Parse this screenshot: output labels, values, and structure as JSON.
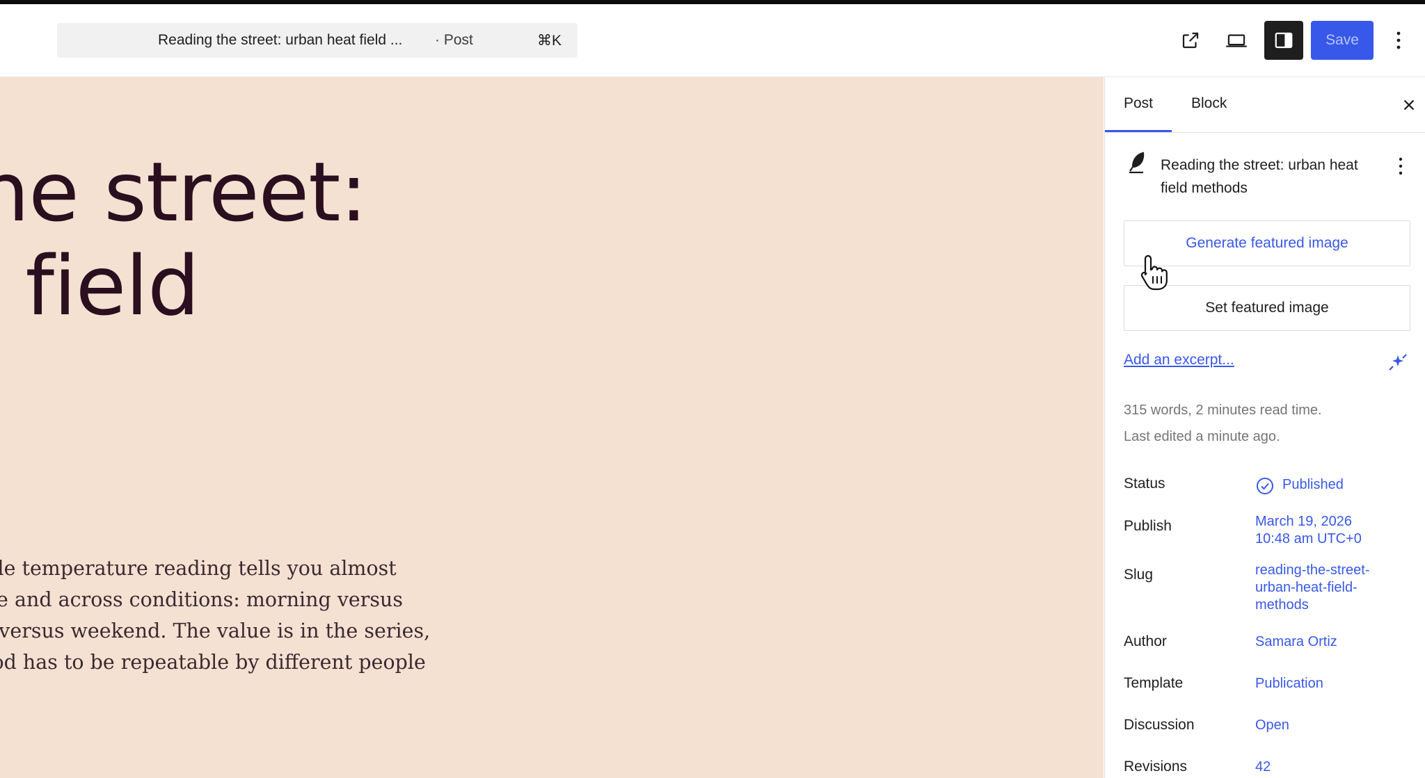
{
  "header": {
    "document_title": "Reading the street: urban heat field ...",
    "document_type": "· Post",
    "shortcut": "⌘K",
    "save_label": "Save"
  },
  "canvas": {
    "title_lines": "ng the street:\n heat field\nods",
    "excerpt": "matter A single temperature reading tells you almost\nerge over time and across conditions: morning versus\near, weekday versus weekend. The value is in the series,\nans the method has to be repeatable by different people\n. If your..."
  },
  "sidebar": {
    "tabs": [
      "Post",
      "Block"
    ],
    "active_tab": "Post",
    "post_title": "Reading the street: urban heat field methods",
    "generate_featured_label": "Generate featured image",
    "set_featured_label": "Set featured image",
    "excerpt_link": "Add an excerpt...",
    "word_count": "315 words, 2 minutes read time.",
    "last_edited": "Last edited a minute ago.",
    "fields": [
      {
        "label": "Status",
        "value": "Published"
      },
      {
        "label": "Publish",
        "value": "March 19, 2026\n10:48 am UTC+0"
      },
      {
        "label": "Slug",
        "value": "reading-the-street-\nurban-heat-field-\nmethods"
      },
      {
        "label": "Author",
        "value": "Samara Ortiz"
      },
      {
        "label": "Template",
        "value": "Publication"
      },
      {
        "label": "Discussion",
        "value": "Open"
      },
      {
        "label": "Revisions",
        "value": "42"
      }
    ]
  },
  "icons": {
    "view": "external-link-icon",
    "preview": "desktop-preview-icon",
    "settings": "sidebar-toggle-icon",
    "options": "more-vertical-icon",
    "close": "close-icon",
    "post_card": "feather-icon",
    "ai": "ai-sparkle-icon",
    "status": "check-circle-icon",
    "cursor": "hand-pointer-icon"
  },
  "colors": {
    "accent": "#3858e9",
    "canvas_bg": "#f5e1d2",
    "title_color": "#2b0f1f"
  }
}
